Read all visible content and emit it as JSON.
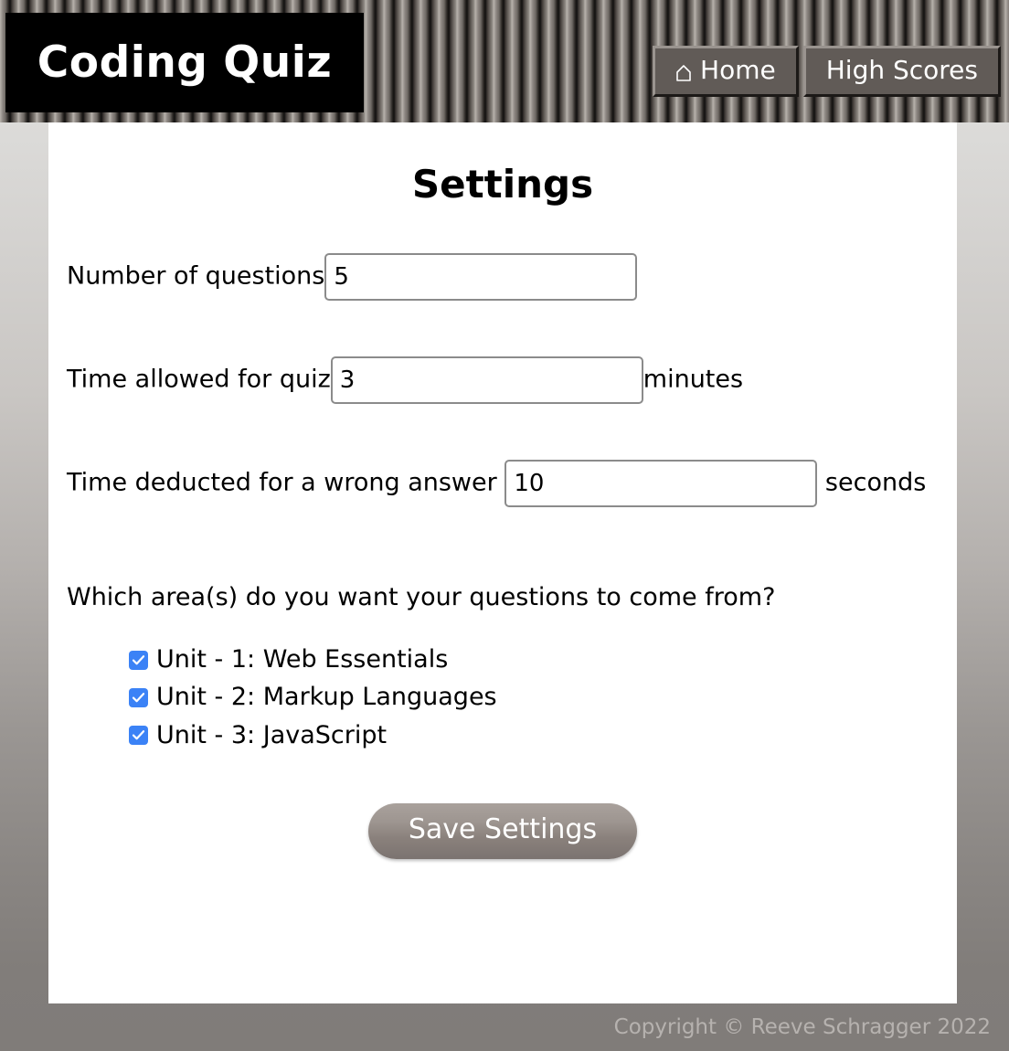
{
  "header": {
    "brand_title": "Coding Quiz",
    "nav": [
      {
        "label": "Home",
        "icon": "home-icon"
      },
      {
        "label": "High Scores",
        "icon": ""
      }
    ]
  },
  "main": {
    "page_title": "Settings",
    "fields": [
      {
        "label": "Number of questions",
        "value": "5",
        "placeholder": "",
        "suffix": ""
      },
      {
        "label": "Time allowed for quiz",
        "value": "3",
        "placeholder": "",
        "suffix": "minutes"
      },
      {
        "label": "Time deducted for a wrong answer",
        "value": "10",
        "placeholder": "",
        "suffix": "seconds"
      }
    ],
    "question_prompt": "Which area(s) do you want your questions to come from?",
    "options": [
      {
        "label": "Unit - 1: Web Essentials",
        "checked": true
      },
      {
        "label": "Unit - 2: Markup Languages",
        "checked": true
      },
      {
        "label": "Unit - 3: JavaScript",
        "checked": true
      }
    ],
    "save_label": "Save Settings"
  },
  "footer": {
    "copyright": "Copyright © Reeve Schragger 2022"
  },
  "colors": {
    "accent_checkbox": "#3b82f6",
    "header_stripe_light": "#b9b4ae",
    "header_stripe_dark": "#100f0e",
    "brand_block": "#000000",
    "nav_button": "#615b57",
    "card": "#ffffff",
    "footer_text": "#b6b2af"
  }
}
